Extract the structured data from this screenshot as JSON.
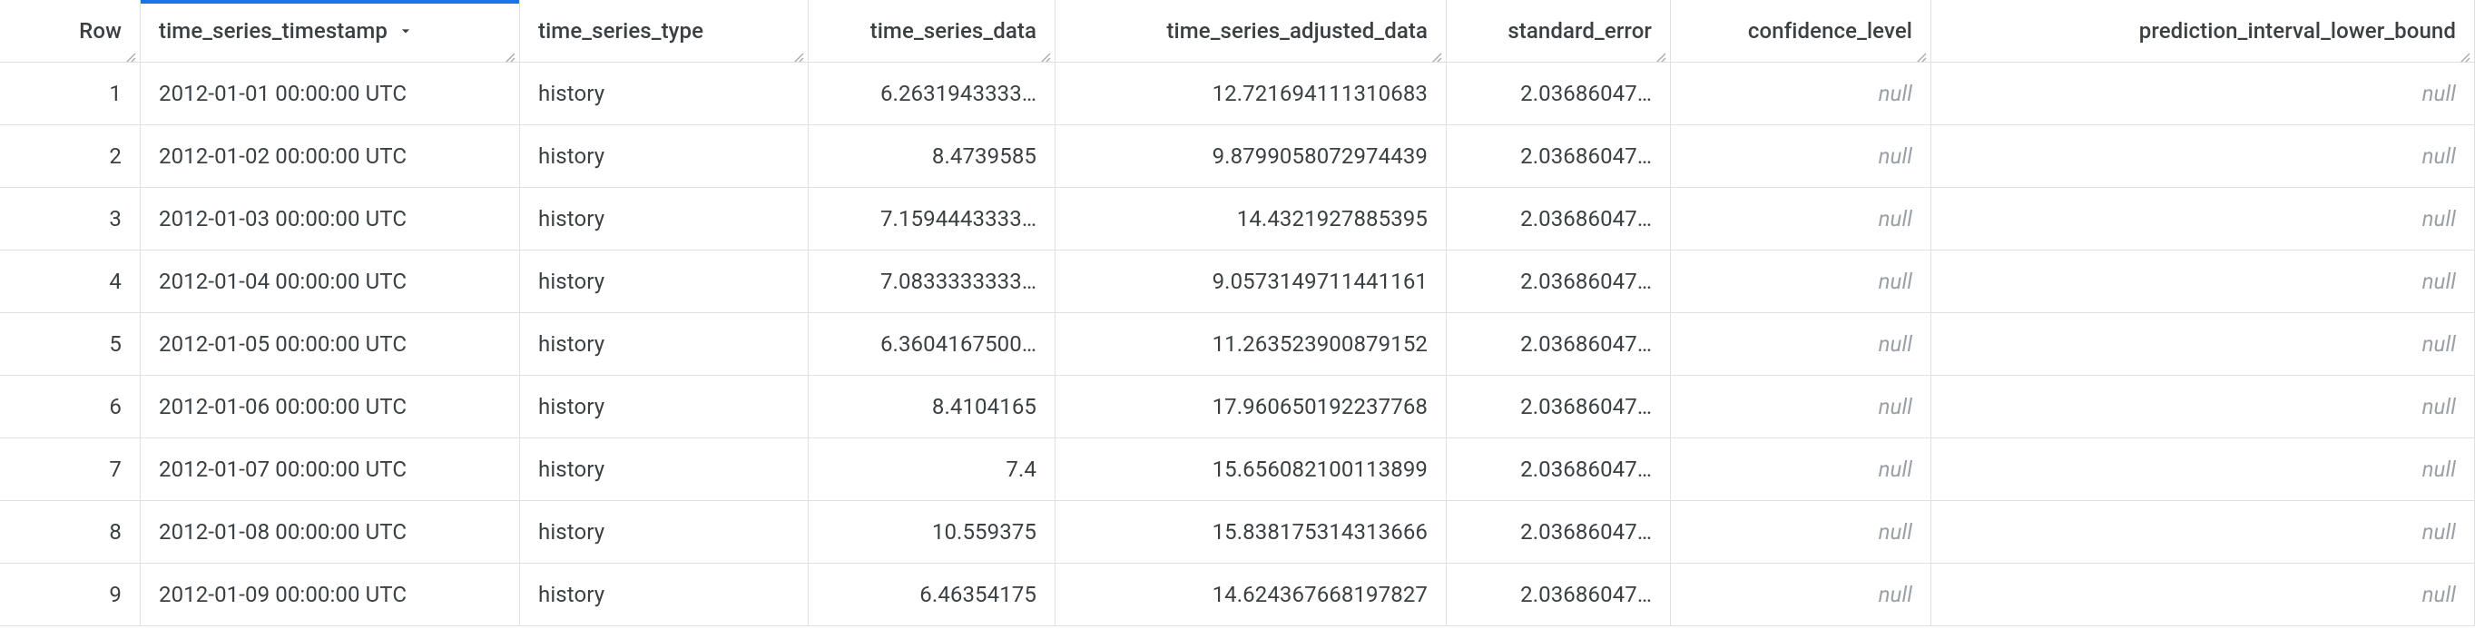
{
  "table": {
    "sorted_column_index": 1,
    "columns": [
      {
        "key": "row",
        "label": "Row",
        "align": "right",
        "sortable": true
      },
      {
        "key": "ts",
        "label": "time_series_timestamp",
        "align": "left",
        "sortable": true
      },
      {
        "key": "type",
        "label": "time_series_type",
        "align": "left",
        "sortable": true
      },
      {
        "key": "data",
        "label": "time_series_data",
        "align": "right",
        "sortable": true
      },
      {
        "key": "adj",
        "label": "time_series_adjusted_data",
        "align": "right",
        "sortable": true
      },
      {
        "key": "se",
        "label": "standard_error",
        "align": "right",
        "sortable": true
      },
      {
        "key": "cl",
        "label": "confidence_level",
        "align": "right",
        "sortable": true
      },
      {
        "key": "pilb",
        "label": "prediction_interval_lower_bound",
        "align": "right",
        "sortable": true
      }
    ],
    "rows": [
      {
        "row": "1",
        "ts": "2012-01-01 00:00:00 UTC",
        "type": "history",
        "data": "6.2631943333…",
        "adj": "12.721694111310683",
        "se": "2.03686047…",
        "cl": null,
        "pilb": null
      },
      {
        "row": "2",
        "ts": "2012-01-02 00:00:00 UTC",
        "type": "history",
        "data": "8.4739585",
        "adj": "9.8799058072974439",
        "se": "2.03686047…",
        "cl": null,
        "pilb": null
      },
      {
        "row": "3",
        "ts": "2012-01-03 00:00:00 UTC",
        "type": "history",
        "data": "7.1594443333…",
        "adj": "14.4321927885395",
        "se": "2.03686047…",
        "cl": null,
        "pilb": null
      },
      {
        "row": "4",
        "ts": "2012-01-04 00:00:00 UTC",
        "type": "history",
        "data": "7.0833333333…",
        "adj": "9.0573149711441161",
        "se": "2.03686047…",
        "cl": null,
        "pilb": null
      },
      {
        "row": "5",
        "ts": "2012-01-05 00:00:00 UTC",
        "type": "history",
        "data": "6.3604167500…",
        "adj": "11.263523900879152",
        "se": "2.03686047…",
        "cl": null,
        "pilb": null
      },
      {
        "row": "6",
        "ts": "2012-01-06 00:00:00 UTC",
        "type": "history",
        "data": "8.4104165",
        "adj": "17.960650192237768",
        "se": "2.03686047…",
        "cl": null,
        "pilb": null
      },
      {
        "row": "7",
        "ts": "2012-01-07 00:00:00 UTC",
        "type": "history",
        "data": "7.4",
        "adj": "15.656082100113899",
        "se": "2.03686047…",
        "cl": null,
        "pilb": null
      },
      {
        "row": "8",
        "ts": "2012-01-08 00:00:00 UTC",
        "type": "history",
        "data": "10.559375",
        "adj": "15.838175314313666",
        "se": "2.03686047…",
        "cl": null,
        "pilb": null
      },
      {
        "row": "9",
        "ts": "2012-01-09 00:00:00 UTC",
        "type": "history",
        "data": "6.46354175",
        "adj": "14.624367668197827",
        "se": "2.03686047…",
        "cl": null,
        "pilb": null
      }
    ],
    "null_text": "null"
  }
}
